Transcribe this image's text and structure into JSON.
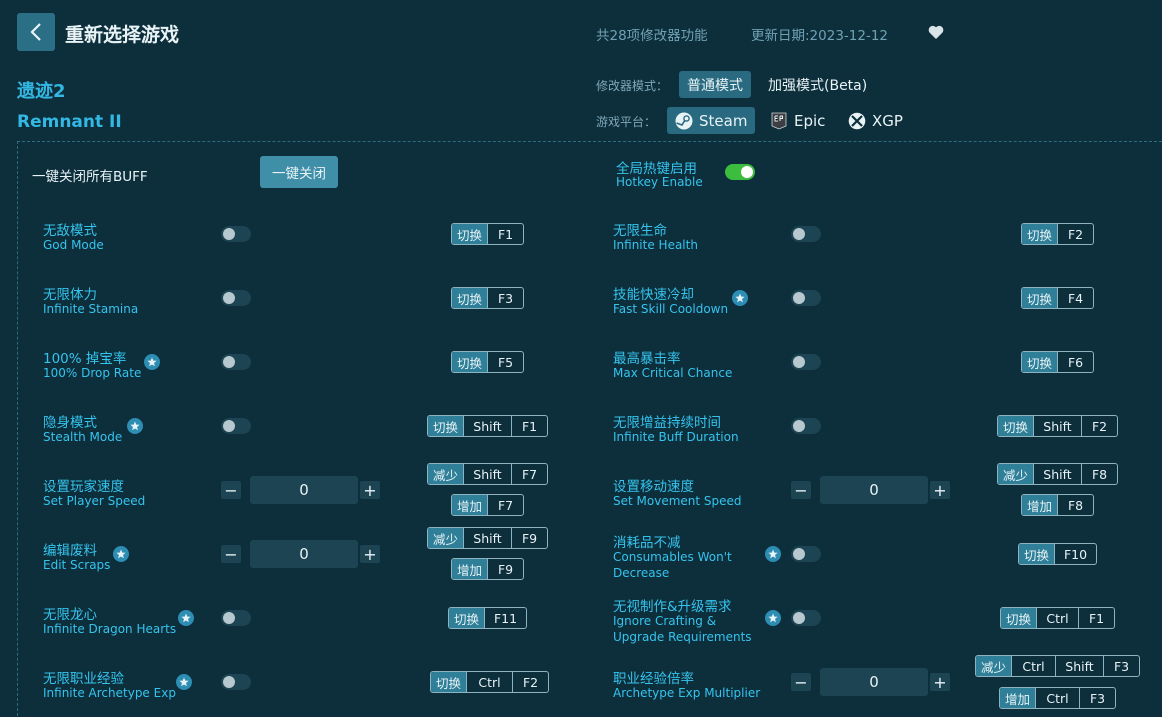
{
  "header": {
    "title": "重新选择游戏",
    "feature_count": "共28项修改器功能",
    "update_date": "更新日期:2023-12-12"
  },
  "game": {
    "name_cn": "遗迹2",
    "name_en": "Remnant II"
  },
  "mode": {
    "label": "修改器模式：",
    "options": [
      "普通模式",
      "加强模式(Beta)"
    ],
    "selected": "普通模式"
  },
  "platform": {
    "label": "游戏平台：",
    "options": [
      "Steam",
      "Epic",
      "XGP"
    ],
    "selected": "Steam"
  },
  "global": {
    "close_all_label": "一键关闭所有BUFF",
    "close_all_button": "一键关闭",
    "hotkey_cn": "全局热键启用",
    "hotkey_en": "Hotkey Enable",
    "hotkey_enabled": true
  },
  "features": [
    {
      "cn": "无敌模式",
      "en": "God Mode",
      "key_toggle": [
        "切换",
        "F1"
      ]
    },
    {
      "cn": "无限生命",
      "en": "Infinite Health",
      "key_toggle": [
        "切换",
        "F2"
      ]
    },
    {
      "cn": "无限体力",
      "en": "Infinite Stamina",
      "key_toggle": [
        "切换",
        "F3"
      ]
    },
    {
      "cn": "技能快速冷却",
      "en": "Fast Skill Cooldown",
      "starred": true,
      "key_toggle": [
        "切换",
        "F4"
      ]
    },
    {
      "cn": "100% 掉宝率",
      "en": "100% Drop Rate",
      "starred": true,
      "key_toggle": [
        "切换",
        "F5"
      ]
    },
    {
      "cn": "最高暴击率",
      "en": "Max Critical Chance",
      "key_toggle": [
        "切换",
        "F6"
      ]
    },
    {
      "cn": "隐身模式",
      "en": "Stealth Mode",
      "starred": true,
      "key_toggle": [
        "切换",
        "Shift",
        "F1"
      ]
    },
    {
      "cn": "无限增益持续时间",
      "en": "Infinite Buff Duration",
      "key_toggle": [
        "切换",
        "Shift",
        "F2"
      ]
    },
    {
      "cn": "设置玩家速度",
      "en": "Set Player Speed",
      "value": "0",
      "key_dec": [
        "减少",
        "Shift",
        "F7"
      ],
      "key_inc": [
        "增加",
        "F7"
      ]
    },
    {
      "cn": "设置移动速度",
      "en": "Set Movement Speed",
      "value": "0",
      "key_dec": [
        "减少",
        "Shift",
        "F8"
      ],
      "key_inc": [
        "增加",
        "F8"
      ]
    },
    {
      "cn": "编辑废料",
      "en": "Edit Scraps",
      "starred": true,
      "value": "0",
      "key_dec": [
        "减少",
        "Shift",
        "F9"
      ],
      "key_inc": [
        "增加",
        "F9"
      ]
    },
    {
      "cn": "消耗品不减",
      "en1": "Consumables Won't",
      "en2": "Decrease",
      "starred": true,
      "key_toggle": [
        "切换",
        "F10"
      ]
    },
    {
      "cn": "无限龙心",
      "en": "Infinite Dragon Hearts",
      "starred": true,
      "key_toggle": [
        "切换",
        "F11"
      ]
    },
    {
      "cn": "无视制作&升级需求",
      "en1": "Ignore Crafting &",
      "en2": "Upgrade Requirements",
      "starred": true,
      "key_toggle": [
        "切换",
        "Ctrl",
        "F1"
      ]
    },
    {
      "cn": "无限职业经验",
      "en": "Infinite Archetype Exp",
      "starred": true,
      "key_toggle": [
        "切换",
        "Ctrl",
        "F2"
      ]
    },
    {
      "cn": "职业经验倍率",
      "en": "Archetype Exp Multiplier",
      "value": "0",
      "key_dec": [
        "减少",
        "Ctrl",
        "Shift",
        "F3"
      ],
      "key_inc": [
        "增加",
        "Ctrl",
        "F3"
      ]
    }
  ],
  "icons": {
    "back": "chevron-left-icon",
    "favorite": "heart-icon",
    "star": "star-icon",
    "steam": "steam-icon",
    "epic": "epic-icon",
    "xbox": "xbox-icon"
  },
  "colors": {
    "background": "#0d2e3b",
    "accent": "#35c4ee",
    "button": "#2b6f86",
    "toggle_on": "#3dbd3d"
  }
}
